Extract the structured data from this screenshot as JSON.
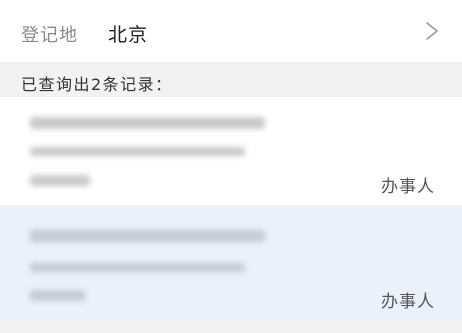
{
  "registration": {
    "label": "登记地",
    "value": "北京"
  },
  "results": {
    "count_text": "已查询出2条记录："
  },
  "records": [
    {
      "handler_label": "办事人"
    },
    {
      "handler_label": "办事人"
    }
  ],
  "colors": {
    "selected_background": "#e9f1fb",
    "card_background": "#ffffff",
    "page_background": "#f2f2f2"
  }
}
